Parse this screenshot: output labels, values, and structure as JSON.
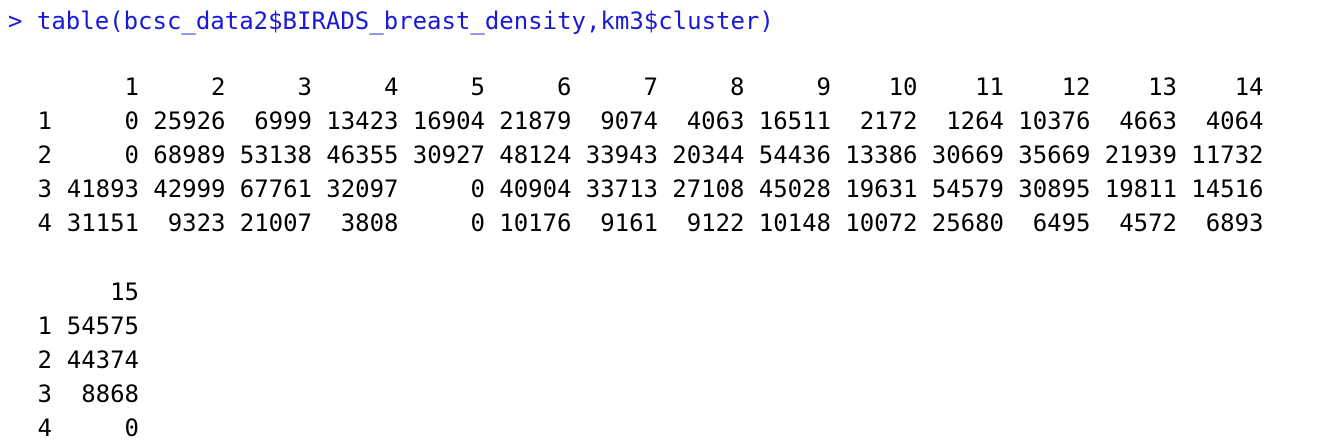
{
  "console": {
    "prompt": ">",
    "command": "table(bcsc_data2$BIRADS_breast_density,km3$cluster)",
    "prompt_color": "#1a1ad6"
  },
  "table_block1": {
    "col_headers": [
      "1",
      "2",
      "3",
      "4",
      "5",
      "6",
      "7",
      "8",
      "9",
      "10",
      "11",
      "12",
      "13",
      "14"
    ],
    "rows": [
      {
        "label": "1",
        "values": [
          "0",
          "25926",
          "6999",
          "13423",
          "16904",
          "21879",
          "9074",
          "4063",
          "16511",
          "2172",
          "1264",
          "10376",
          "4663",
          "4064"
        ]
      },
      {
        "label": "2",
        "values": [
          "0",
          "68989",
          "53138",
          "46355",
          "30927",
          "48124",
          "33943",
          "20344",
          "54436",
          "13386",
          "30669",
          "35669",
          "21939",
          "11732"
        ]
      },
      {
        "label": "3",
        "values": [
          "41893",
          "42999",
          "67761",
          "32097",
          "0",
          "40904",
          "33713",
          "27108",
          "45028",
          "19631",
          "54579",
          "30895",
          "19811",
          "14516"
        ]
      },
      {
        "label": "4",
        "values": [
          "31151",
          "9323",
          "21007",
          "3808",
          "0",
          "10176",
          "9161",
          "9122",
          "10148",
          "10072",
          "25680",
          "6495",
          "4572",
          "6893"
        ]
      }
    ]
  },
  "table_block2": {
    "col_headers": [
      "15"
    ],
    "rows": [
      {
        "label": "1",
        "values": [
          "54575"
        ]
      },
      {
        "label": "2",
        "values": [
          "44374"
        ]
      },
      {
        "label": "3",
        "values": [
          "8868"
        ]
      },
      {
        "label": "4",
        "values": [
          "0"
        ]
      }
    ]
  }
}
